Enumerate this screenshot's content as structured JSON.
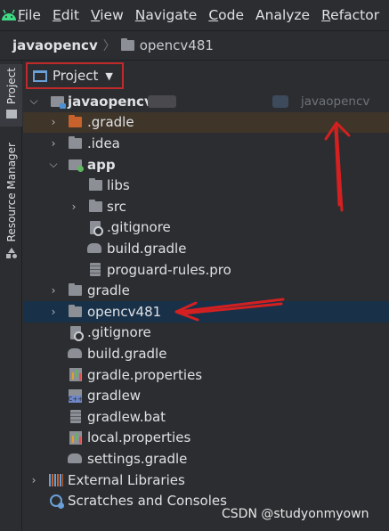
{
  "menubar": {
    "items": [
      {
        "mnemonic": "F",
        "rest": "ile"
      },
      {
        "mnemonic": "E",
        "rest": "dit"
      },
      {
        "mnemonic": "V",
        "rest": "iew"
      },
      {
        "mnemonic": "N",
        "rest": "avigate"
      },
      {
        "mnemonic": "C",
        "rest": "ode"
      },
      {
        "mnemonic": "",
        "rest": "Analyze"
      },
      {
        "mnemonic": "R",
        "rest": "efactor"
      }
    ]
  },
  "breadcrumb": {
    "root": "javaopencv",
    "child": "opencv481"
  },
  "toolwindows": {
    "project": "Project",
    "resource_manager": "Resource Manager"
  },
  "panel": {
    "view_selector": "Project"
  },
  "tree": {
    "root": {
      "label": "javaopencv",
      "module_hint": "javaopencv"
    },
    "gradle_hidden": ".gradle",
    "idea": ".idea",
    "app": "app",
    "libs": "libs",
    "src": "src",
    "app_gitignore": ".gitignore",
    "app_build_gradle": "build.gradle",
    "proguard": "proguard-rules.pro",
    "gradle": "gradle",
    "opencv": "opencv481",
    "root_gitignore": ".gitignore",
    "root_build_gradle": "build.gradle",
    "gradle_properties": "gradle.properties",
    "gradlew": "gradlew",
    "gradlew_bat": "gradlew.bat",
    "local_properties": "local.properties",
    "settings_gradle": "settings.gradle",
    "external_libraries": "External Libraries",
    "scratches": "Scratches and Consoles"
  },
  "watermark": "CSDN @studyonmyown",
  "colors": {
    "annotation_red": "#d42020",
    "selection_blue": "#183148",
    "highlight_orange": "#3f3529",
    "android_green": "#3ddc84"
  }
}
